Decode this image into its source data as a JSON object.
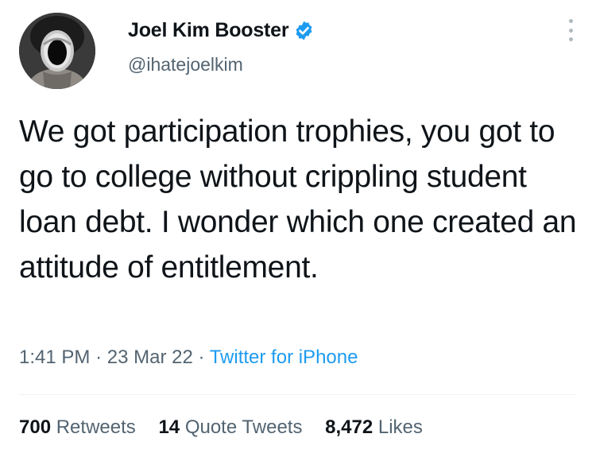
{
  "author": {
    "display_name": "Joel Kim Booster",
    "handle": "@ihatejoelkim",
    "verified": true,
    "avatar_icon": "profile-photo"
  },
  "tweet": {
    "text": "We got participation trophies, you got to go to college without crippling student loan debt. I wonder which one created an attitude of entitlement.",
    "time": "1:41 PM",
    "separator": "·",
    "date": "23 Mar 22",
    "source": "Twitter for iPhone"
  },
  "stats": {
    "retweets_count": "700",
    "retweets_label": "Retweets",
    "quotes_count": "14",
    "quotes_label": "Quote Tweets",
    "likes_count": "8,472",
    "likes_label": "Likes"
  },
  "colors": {
    "text_primary": "#0f1419",
    "text_secondary": "#536471",
    "link": "#1d9bf0",
    "verified_badge": "#1d9bf0"
  },
  "icons": {
    "more": "more-dots-icon",
    "verified": "verified-badge-icon"
  }
}
